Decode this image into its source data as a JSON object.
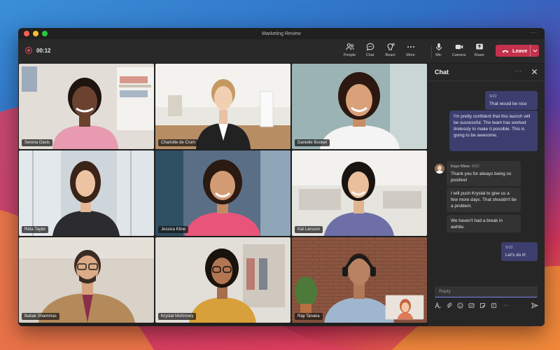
{
  "window": {
    "title": "Marketing Review"
  },
  "toolbar": {
    "timer": "00:12",
    "buttons": [
      {
        "label": "People",
        "icon": "people-icon"
      },
      {
        "label": "Chat",
        "icon": "chat-icon"
      },
      {
        "label": "React",
        "icon": "react-icon"
      },
      {
        "label": "More",
        "icon": "more-icon"
      }
    ],
    "av_buttons": [
      {
        "label": "Mic",
        "icon": "mic-icon"
      },
      {
        "label": "Camera",
        "icon": "camera-icon"
      },
      {
        "label": "Share",
        "icon": "share-icon"
      }
    ],
    "leave_label": "Leave"
  },
  "participants": [
    {
      "name": "Serena Davis"
    },
    {
      "name": "Charlotte de Crum"
    },
    {
      "name": "Danielle Booker"
    },
    {
      "name": "Reta Taylor"
    },
    {
      "name": "Jessica Kline"
    },
    {
      "name": "Kat Larsson"
    },
    {
      "name": "Babak Shammas"
    },
    {
      "name": "Krystal McKinney"
    },
    {
      "name": "Ray Tanaka"
    }
  ],
  "chat": {
    "title": "Chat",
    "messages": [
      {
        "time": "9/22",
        "text": "That would be nice"
      },
      {
        "text": "I'm pretty confident that this launch will be successful. The team has worked tirelessly to make it possible. This is going to be awesome."
      },
      {
        "sender": "Kayo Miwa",
        "time": "9/22",
        "text": "Thank you for always being so positive!"
      },
      {
        "text": "I will push Krystal to give us a few more days. That shouldn't be a problem."
      },
      {
        "text": "We haven't had a break in awhile."
      },
      {
        "time": "9/22",
        "text": "Let's do it!"
      }
    ],
    "reply_placeholder": "Reply"
  },
  "colors": {
    "accent": "#7f85f5",
    "leave": "#c4314b",
    "bubble_out": "#3b3e6e"
  }
}
